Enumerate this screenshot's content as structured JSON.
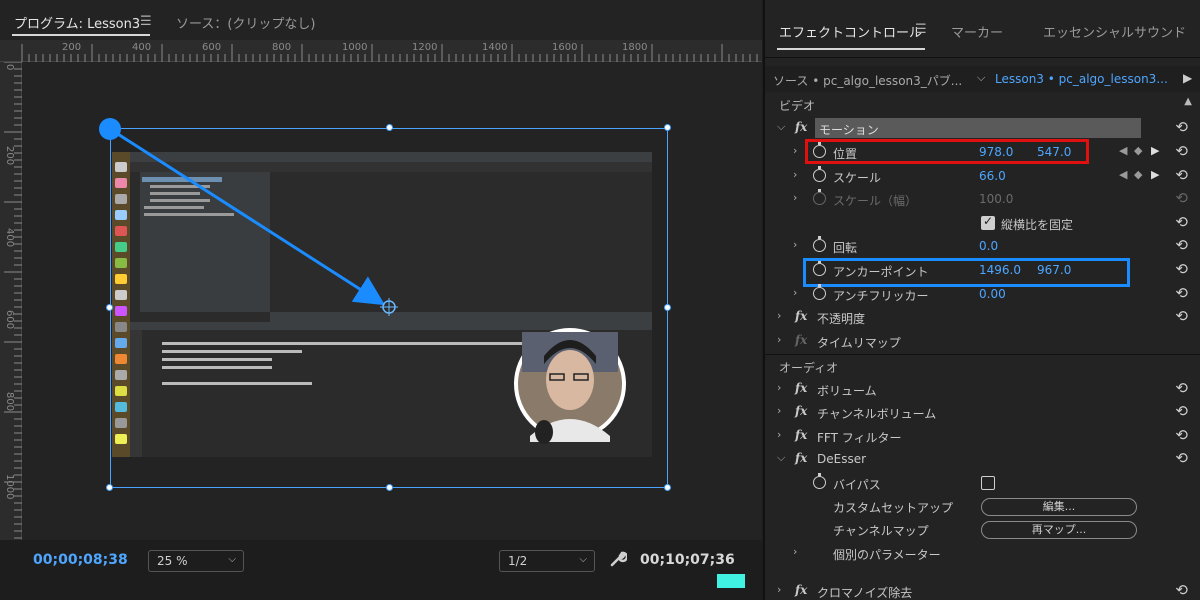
{
  "program": {
    "tab_program": "プログラム: Lesson3",
    "tab_source": "ソース：(クリップなし)",
    "menu_icon": "☰",
    "ruler_top_labels": [
      "200",
      "400",
      "600",
      "800",
      "1000",
      "1200",
      "1400",
      "1600",
      "1800"
    ],
    "ruler_left_labels": [
      "0",
      "200",
      "400",
      "600",
      "800",
      "1000"
    ],
    "timecode_current": "00;00;08;38",
    "zoom": "25 %",
    "resolution": "1/2",
    "timecode_duration": "00;10;07;36",
    "wrench_icon": "wrench-icon",
    "accent_color": "#1a8cff"
  },
  "effects": {
    "tab_effect_controls": "エフェクトコントロール",
    "tab_marker": "マーカー",
    "tab_essential_sound": "エッセンシャルサウンド",
    "menu_icon": "☰",
    "source_label": "ソース • pc_algo_lesson3_パブ...",
    "sequence_label": "Lesson3 • pc_algo_lesson3...",
    "video_section": "ビデオ",
    "audio_section": "オーディオ",
    "motion": {
      "label": "モーション",
      "position_label": "位置",
      "position_x": "978.0",
      "position_y": "547.0",
      "scale_label": "スケール",
      "scale_value": "66.0",
      "scale_width_label": "スケール（幅）",
      "scale_width_value": "100.0",
      "uniform_scale_label": "縦横比を固定",
      "rotation_label": "回転",
      "rotation_value": "0.0",
      "anchor_label": "アンカーポイント",
      "anchor_x": "1496.0",
      "anchor_y": "967.0",
      "anti_flicker_label": "アンチフリッカー",
      "anti_flicker_value": "0.00"
    },
    "opacity_label": "不透明度",
    "time_remap_label": "タイムリマップ",
    "volume_label": "ボリューム",
    "channel_volume_label": "チャンネルボリューム",
    "fft_label": "FFT フィルター",
    "deesser_label": "DeEsser",
    "bypass_label": "バイパス",
    "custom_setup_label": "カスタムセットアップ",
    "edit_button": "編集...",
    "channel_map_label": "チャンネルマップ",
    "remap_button": "再マップ...",
    "params_label": "個別のパラメーター",
    "chroma_noise_label": "クロマノイズ除去",
    "reset_icon": "⟲",
    "highlight_red": "#e01010",
    "highlight_blue": "#1a8cff"
  }
}
